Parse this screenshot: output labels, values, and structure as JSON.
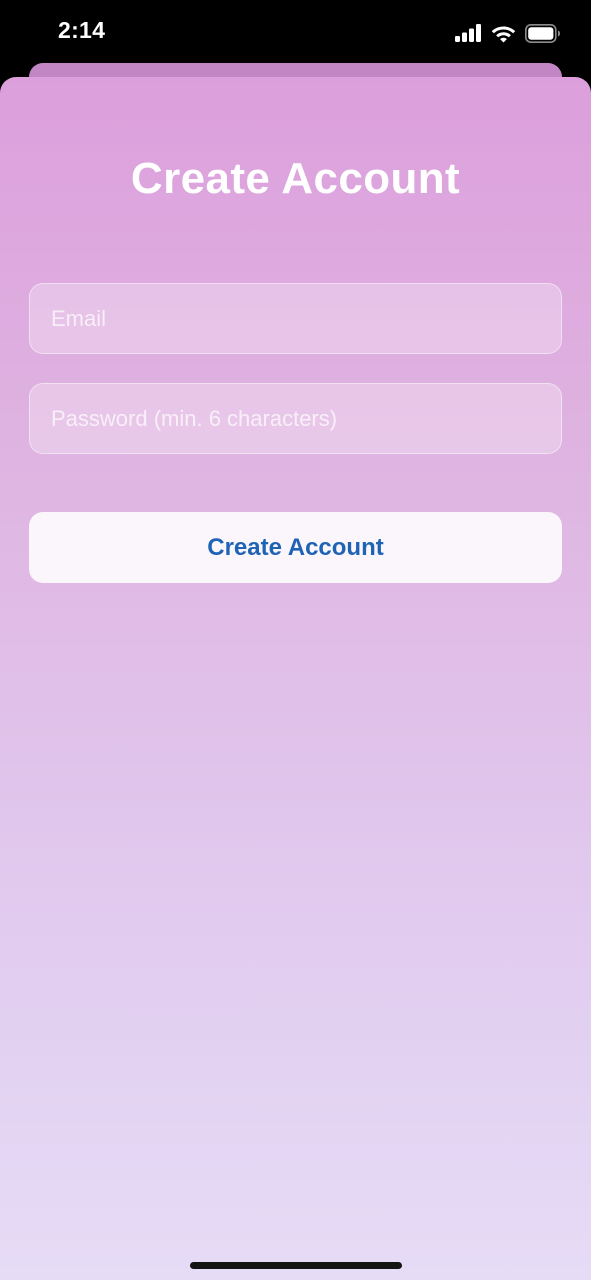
{
  "status_bar": {
    "time": "2:14",
    "icons": [
      "cellular-signal-icon",
      "wifi-icon",
      "battery-icon"
    ]
  },
  "screen": {
    "title": "Create Account"
  },
  "form": {
    "email": {
      "value": "",
      "placeholder": "Email"
    },
    "password": {
      "value": "",
      "placeholder": "Password (min. 6 characters)"
    },
    "submit_label": "Create Account"
  },
  "colors": {
    "gradient_top": "#dc9fdc",
    "gradient_bottom": "#e6dcf6",
    "button_text": "#1f63b5",
    "button_background": "#fbf6fc"
  }
}
